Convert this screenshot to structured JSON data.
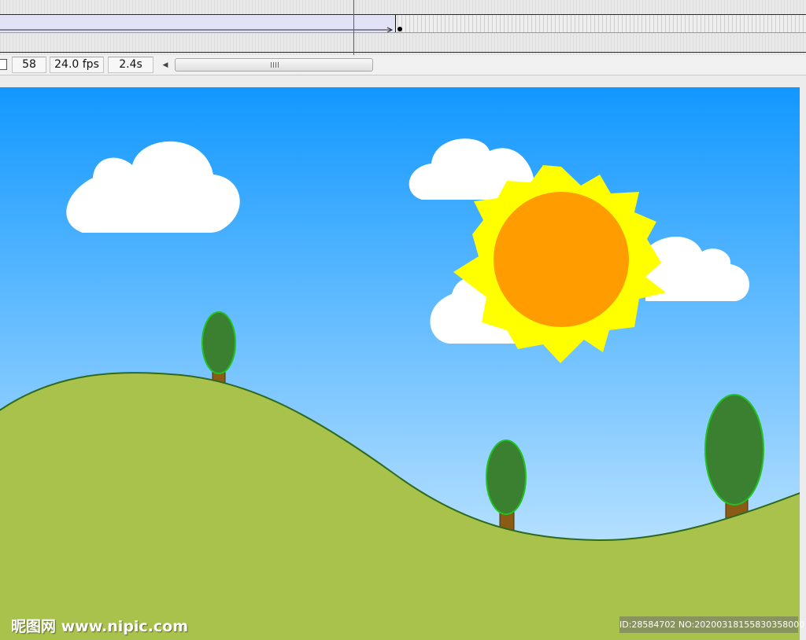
{
  "timeline": {
    "current_frame": "58",
    "frame_rate": "24.0 fps",
    "elapsed_time": "2.4s"
  },
  "colors": {
    "sky_top": "#1298ff",
    "sky_bottom": "#d8efff",
    "hill_fill": "#a8c24c",
    "hill_outline": "#2e6a1e",
    "tree_canopy": "#3a8030",
    "tree_trunk": "#8b5a14",
    "sun_core": "#ff9c00",
    "sun_rays": "#ffff00",
    "cloud": "#ffffff",
    "playhead": "#d0303a",
    "tween_span": "#e2e2f7"
  },
  "watermark": {
    "logo_text": "昵图网 www.nipic.com",
    "id_text": "ID:28584702 NO:20200318155830358000"
  }
}
